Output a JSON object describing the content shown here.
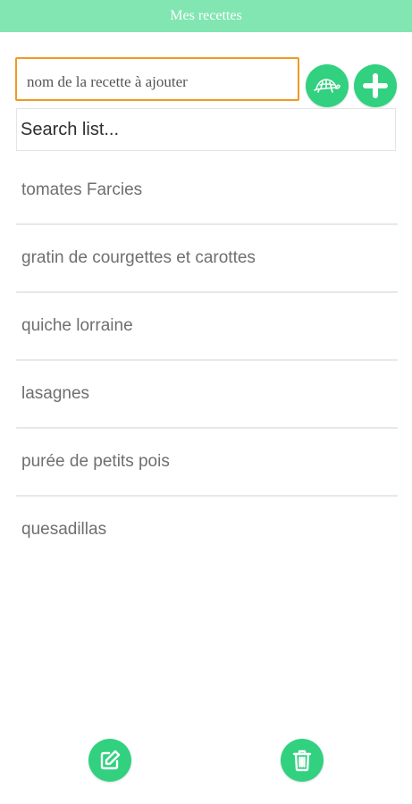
{
  "app": {
    "title": "Mes recettes"
  },
  "add_form": {
    "placeholder": "nom de la recette à ajouter",
    "value": ""
  },
  "search": {
    "placeholder": "Search list...",
    "value": ""
  },
  "recipes": [
    {
      "label": "tomates Farcies"
    },
    {
      "label": "gratin de courgettes et carottes"
    },
    {
      "label": "quiche lorraine"
    },
    {
      "label": "lasagnes"
    },
    {
      "label": "purée de petits pois"
    },
    {
      "label": "quesadillas"
    }
  ],
  "icons": {
    "turtle_button": "turtle-icon",
    "add_button": "plus-icon",
    "edit_button": "edit-icon",
    "delete_button": "trash-icon"
  },
  "colors": {
    "title_bar": "#82e6b2",
    "accent": "#31d17f",
    "input_focus_border": "#f09a24",
    "list_text": "#6f6f6f",
    "divider": "#e8e8e8"
  }
}
